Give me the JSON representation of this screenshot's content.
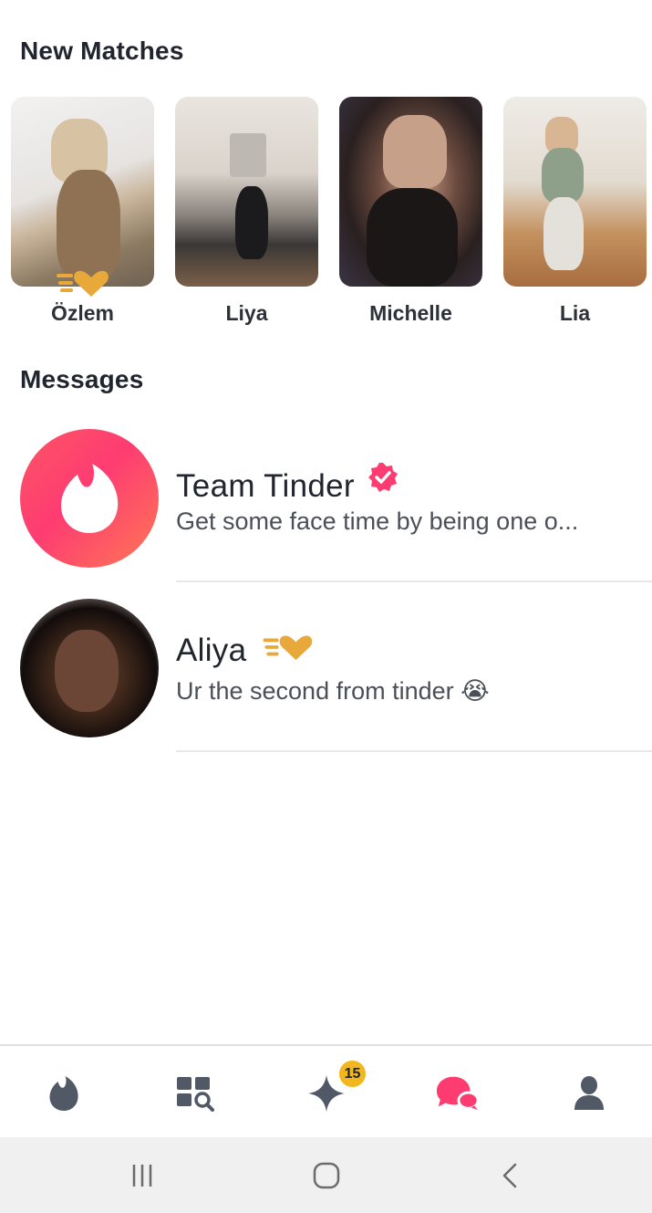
{
  "new_matches": {
    "title": "New Matches",
    "items": [
      {
        "name": "Özlem",
        "has_gold_like_badge": true
      },
      {
        "name": "Liya",
        "has_gold_like_badge": false
      },
      {
        "name": "Michelle",
        "has_gold_like_badge": false
      },
      {
        "name": "Lia",
        "has_gold_like_badge": false
      }
    ]
  },
  "messages": {
    "title": "Messages",
    "items": [
      {
        "name": "Team Tinder",
        "preview": "Get some face time by being one o...",
        "verified": true,
        "avatar_icon": "tinder-flame-icon"
      },
      {
        "name": "Aliya",
        "preview": "Ur the second from tinder",
        "preview_emoji": "😭",
        "gold_like_badge": true
      }
    ]
  },
  "bottom_nav": {
    "items": [
      {
        "icon": "flame-icon",
        "active": false
      },
      {
        "icon": "explore-grid-icon",
        "active": false
      },
      {
        "icon": "sparkle-icon",
        "active": false,
        "badge": "15"
      },
      {
        "icon": "chat-bubbles-icon",
        "active": true
      },
      {
        "icon": "profile-icon",
        "active": false
      }
    ]
  },
  "system_nav": {
    "items": [
      "recent-apps-icon",
      "home-icon",
      "back-icon"
    ]
  },
  "colors": {
    "tinder_gradient_start": "#fd5564",
    "tinder_gradient_end": "#ff7854",
    "active_nav": "#fe3c72",
    "inactive_nav": "#505965",
    "gold": "#e8a93a",
    "badge_gold": "#f2b71f",
    "verified": "#fe3c72"
  }
}
